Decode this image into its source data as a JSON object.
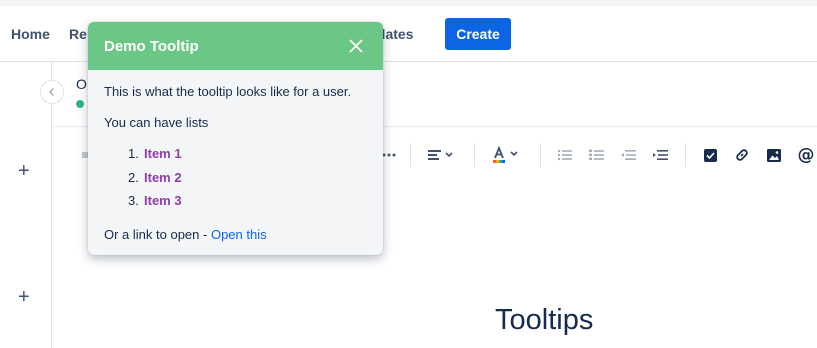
{
  "nav": {
    "home": "Home",
    "recent_partial": "Re",
    "templates_partial": "plates",
    "create": "Create"
  },
  "page": {
    "owner_partial": "O",
    "title": "Tooltips"
  },
  "tooltip": {
    "title": "Demo Tooltip",
    "line1": "This is what the tooltip looks like for a user.",
    "line2": "You can have lists",
    "list": [
      {
        "num": "1.",
        "label": "Item 1"
      },
      {
        "num": "2.",
        "label": "Item 2"
      },
      {
        "num": "3.",
        "label": "Item 3"
      }
    ],
    "link_prefix": "Or a link to open - ",
    "link_label": "Open this"
  },
  "colors": {
    "accent": "#0c66e4",
    "tooltip_header": "#6bc785",
    "list_item": "#8f3fab",
    "status": "#36b37e"
  },
  "toolbar": {
    "icons": [
      "more-icon",
      "align-icon",
      "text-color-icon",
      "bullet-list-icon",
      "numbered-list-icon",
      "outdent-icon",
      "indent-icon",
      "task-icon",
      "link-icon",
      "image-icon",
      "mention-icon"
    ]
  }
}
